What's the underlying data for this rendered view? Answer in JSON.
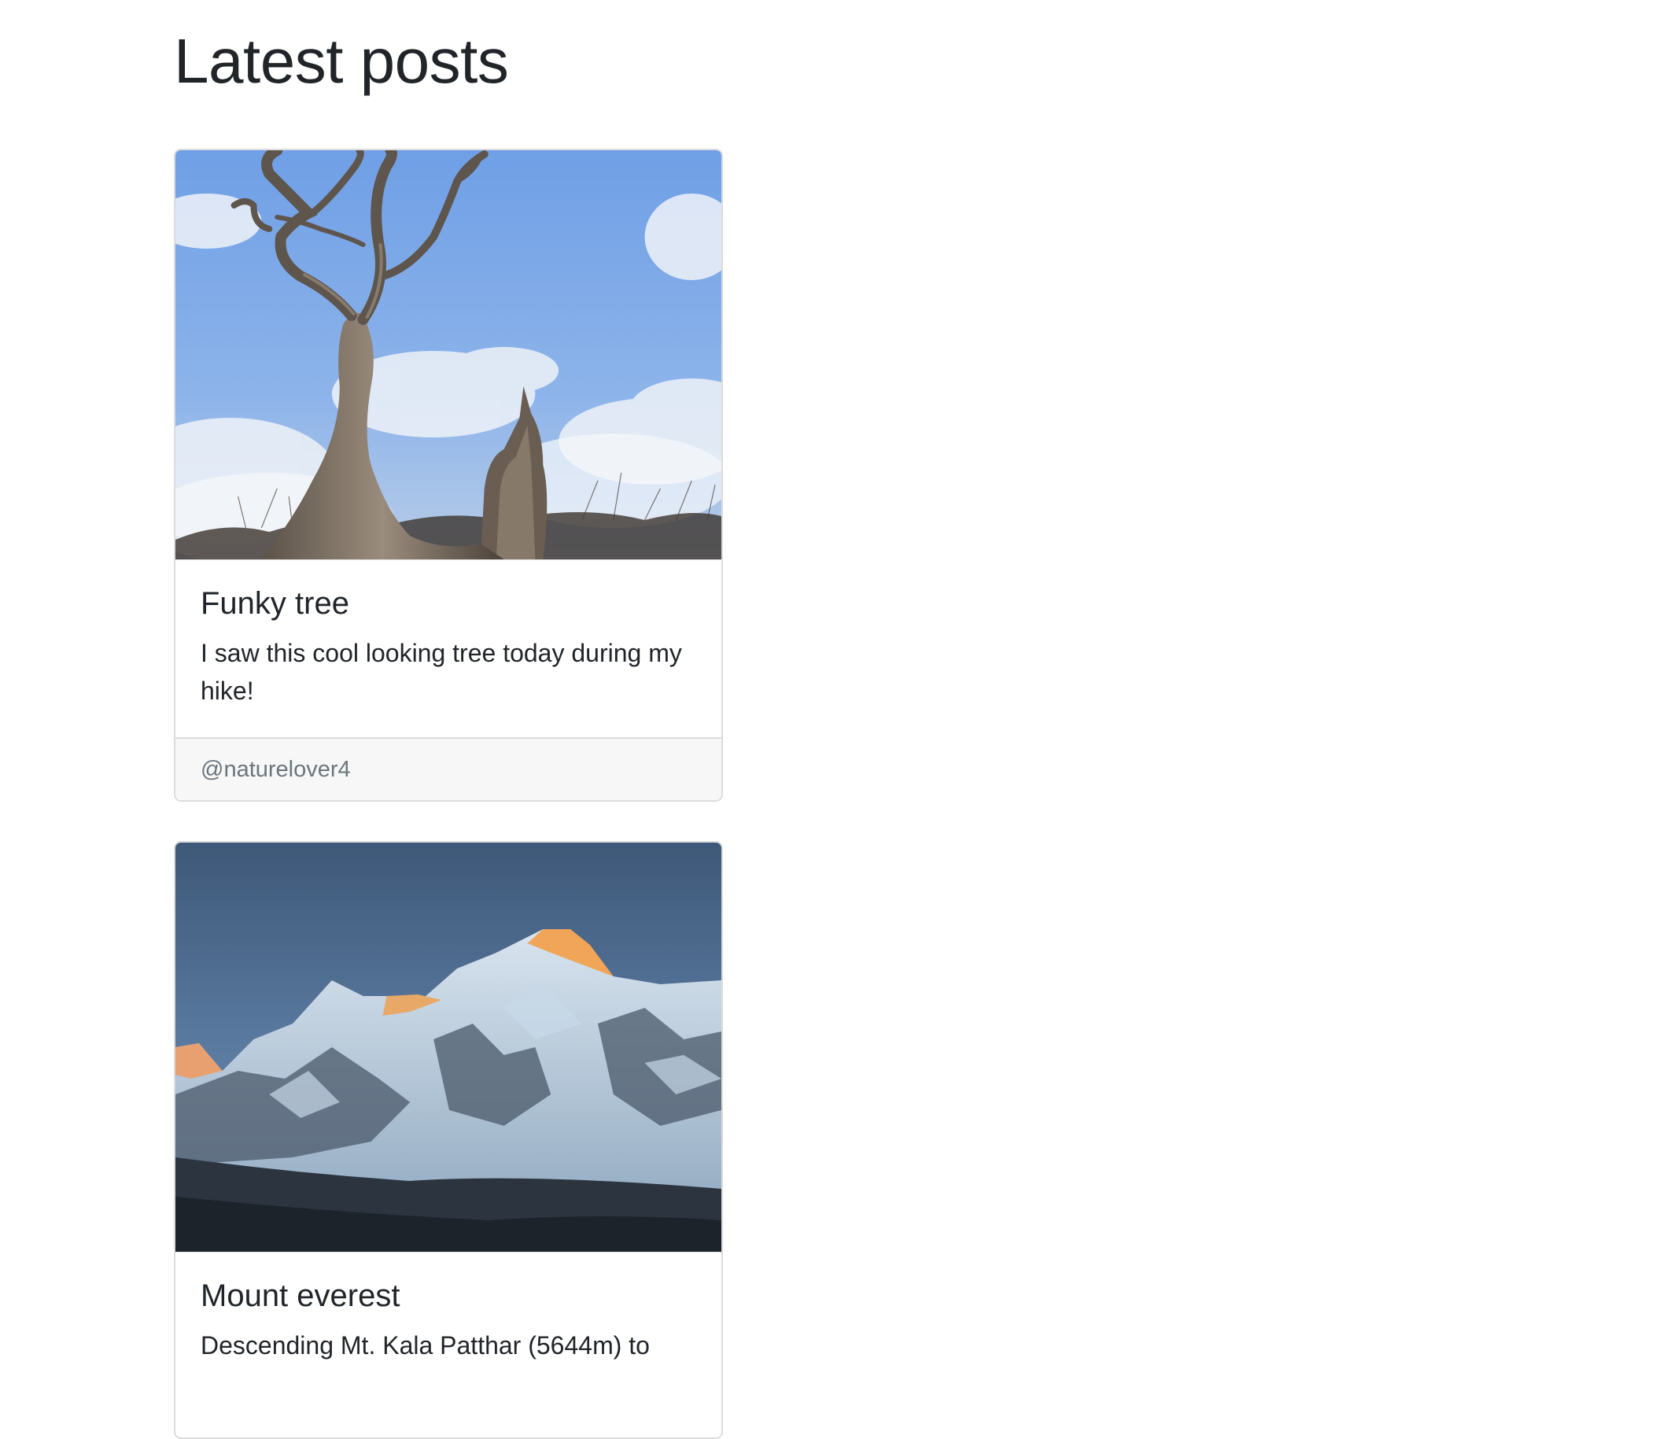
{
  "page": {
    "title": "Latest posts"
  },
  "posts": [
    {
      "title": "Funky tree",
      "body": "I saw this cool looking tree today during my hike!",
      "author": "@naturelover4",
      "image": "photo of a gnarled dead tree against a blue sky with clouds"
    },
    {
      "title": "Mount everest",
      "body": "Descending Mt. Kala Patthar (5644m) to",
      "author": "",
      "image": "photo of snow-covered Himalayan peaks with sunlit summit at dusk"
    }
  ],
  "colors": {
    "text": "#212529",
    "muted": "#6c757d",
    "border": "#dcdcdc",
    "footer_bg": "#f7f7f7"
  }
}
